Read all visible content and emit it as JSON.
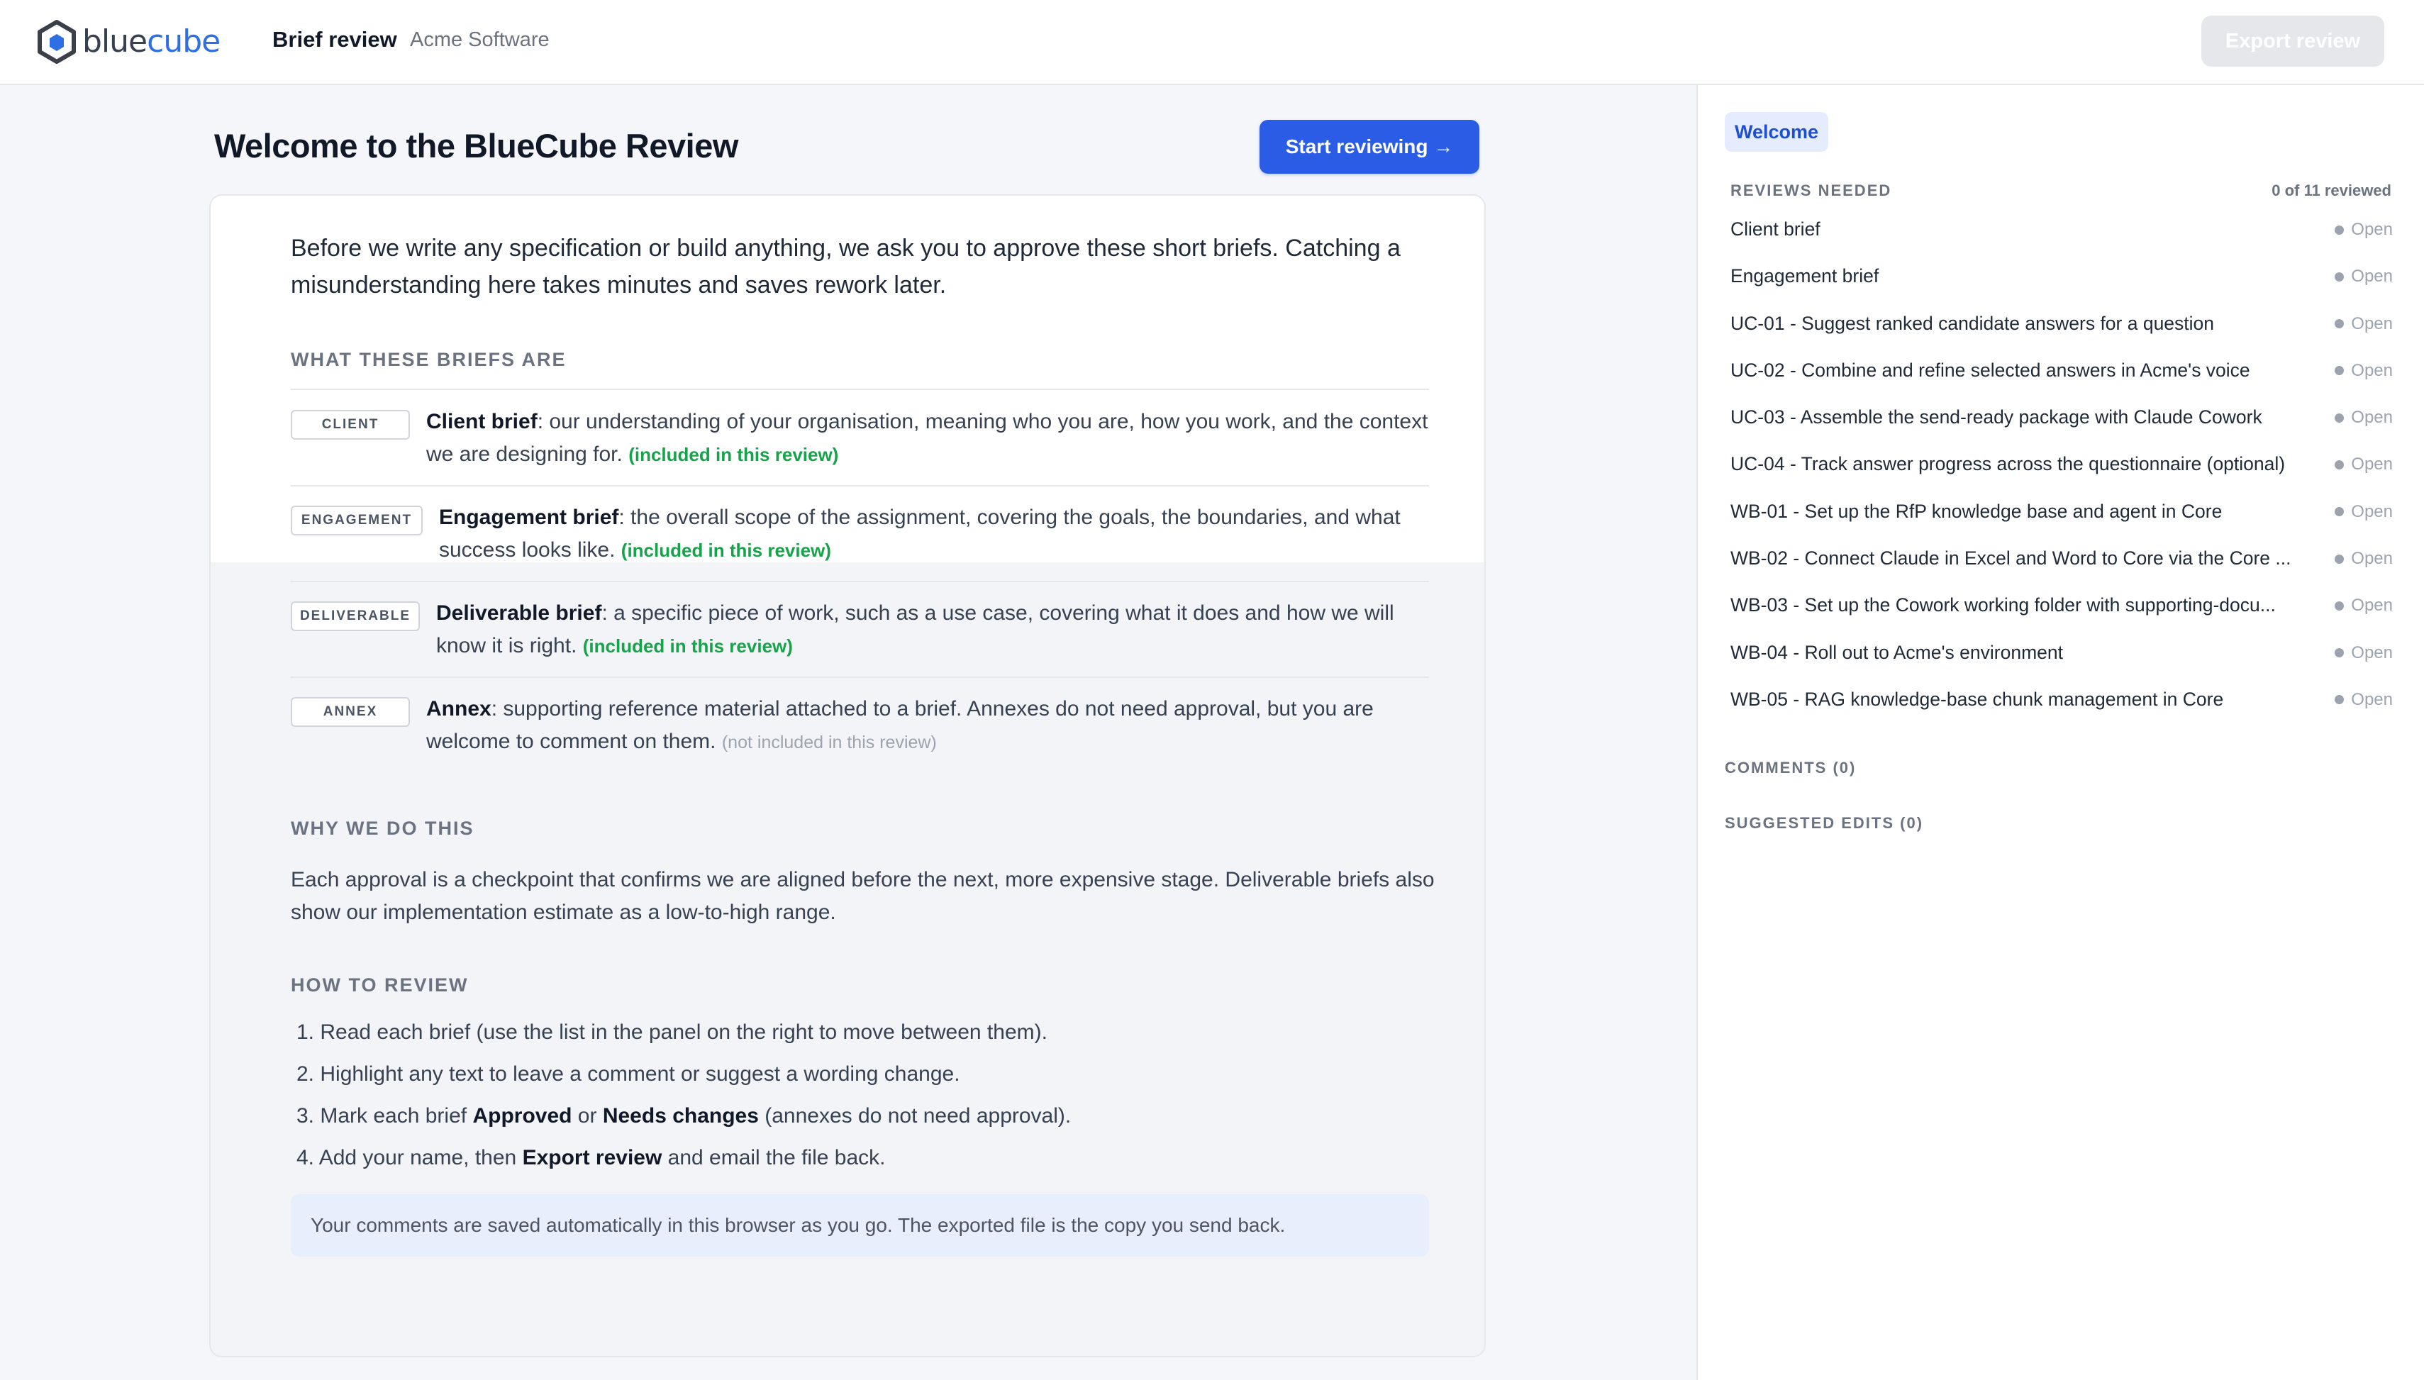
{
  "header": {
    "logo_text_a": "blue",
    "logo_text_b": "cube",
    "title": "Brief review",
    "client": "Acme Software",
    "export_label": "Export review"
  },
  "main": {
    "title": "Welcome to the BlueCube Review",
    "start_label": "Start reviewing →",
    "intro": "Before we write any specification or build anything, we ask you to approve these short briefs. Catching a misunderstanding here takes minutes and saves rework later.",
    "what_heading": "WHAT THESE BRIEFS ARE",
    "briefs": [
      {
        "tag": "CLIENT",
        "name": "Client brief",
        "desc": ": our understanding of your organisation, meaning who you are, how you work, and the context we are designing for.",
        "note": "(included in this review)"
      },
      {
        "tag": "ENGAGEMENT",
        "name": "Engagement brief",
        "desc": ": the overall scope of the assignment, covering the goals, the boundaries, and what success looks like.",
        "note": "(included in this review)"
      },
      {
        "tag": "DELIVERABLE",
        "name": "Deliverable brief",
        "desc": ": a specific piece of work, such as a use case, covering what it does and how we will know it is right.",
        "note": "(included in this review)"
      },
      {
        "tag": "ANNEX",
        "name": "Annex",
        "desc": ": supporting reference material attached to a brief. Annexes do not need approval, but you are welcome to comment on them.",
        "note": "(not included in this review)"
      }
    ],
    "why_heading": "WHY WE DO THIS",
    "why_text": "Each approval is a checkpoint that confirms we are aligned before the next, more expensive stage. Deliverable briefs also show our implementation estimate as a low-to-high range.",
    "how_heading": "HOW TO REVIEW",
    "steps": {
      "s1": "Read each brief (use the list in the panel on the right to move between them).",
      "s2": "Highlight any text to leave a comment or suggest a wording change.",
      "s3_a": "Mark each brief ",
      "s3_b": "Approved",
      "s3_c": " or ",
      "s3_d": "Needs changes",
      "s3_e": " (annexes do not need approval).",
      "s4_a": "Add your name, then ",
      "s4_b": "Export review",
      "s4_c": " and email the file back."
    },
    "note": "Your comments are saved automatically in this browser as you go. The exported file is the copy you send back."
  },
  "panel": {
    "welcome": "Welcome",
    "reviews_heading": "REVIEWS NEEDED",
    "reviews_count": "0 of 11 reviewed",
    "reviews": [
      {
        "label": "Client brief",
        "status": "Open"
      },
      {
        "label": "Engagement brief",
        "status": "Open"
      },
      {
        "label": "UC-01 - Suggest ranked candidate answers for a question",
        "status": "Open"
      },
      {
        "label": "UC-02 - Combine and refine selected answers in Acme's voice",
        "status": "Open"
      },
      {
        "label": "UC-03 - Assemble the send-ready package with Claude Cowork",
        "status": "Open"
      },
      {
        "label": "UC-04 - Track answer progress across the questionnaire (optional)",
        "status": "Open"
      },
      {
        "label": "WB-01 - Set up the RfP knowledge base and agent in Core",
        "status": "Open"
      },
      {
        "label": "WB-02 - Connect Claude in Excel and Word to Core via the Core ...",
        "status": "Open"
      },
      {
        "label": "WB-03 - Set up the Cowork working folder with supporting-docu...",
        "status": "Open"
      },
      {
        "label": "WB-04 - Roll out to Acme's environment",
        "status": "Open"
      },
      {
        "label": "WB-05 - RAG knowledge-base chunk management in Core",
        "status": "Open"
      }
    ],
    "comments_heading": "COMMENTS (0)",
    "edits_heading": "SUGGESTED EDITS (0)"
  },
  "colors": {
    "brand": "#2f6fe4",
    "primary_button": "#2b5ce6",
    "included": "#16a34a",
    "status_open": "#9ca3af"
  }
}
